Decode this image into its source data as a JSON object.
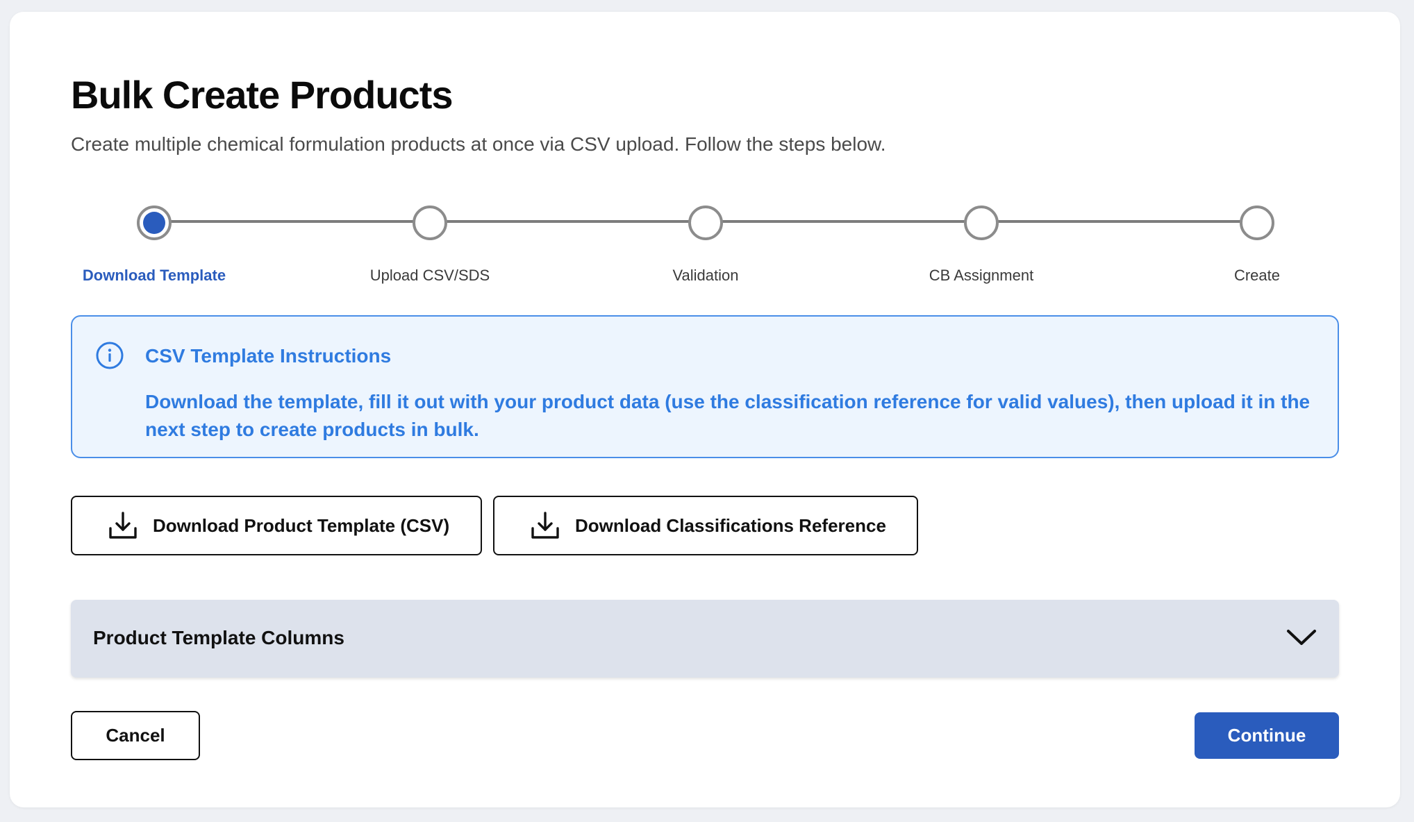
{
  "page": {
    "title": "Bulk Create Products",
    "subtitle": "Create multiple chemical formulation products at once via CSV upload. Follow the steps below."
  },
  "stepper": {
    "active_index": 0,
    "steps": [
      {
        "label": "Download Template"
      },
      {
        "label": "Upload CSV/SDS"
      },
      {
        "label": "Validation"
      },
      {
        "label": "CB Assignment"
      },
      {
        "label": "Create"
      }
    ]
  },
  "info": {
    "icon": "info-circle-icon",
    "title": "CSV Template Instructions",
    "body": "Download the template, fill it out with your product data (use the classification reference for valid values), then upload it in the next step to create products in bulk."
  },
  "downloads": {
    "template_label": "Download Product Template (CSV)",
    "classifications_label": "Download Classifications Reference",
    "icon": "download-icon"
  },
  "accordion": {
    "title": "Product Template Columns",
    "expanded": false,
    "icon": "chevron-down-icon"
  },
  "footer": {
    "cancel_label": "Cancel",
    "continue_label": "Continue"
  },
  "colors": {
    "primary": "#2a5cbd",
    "info_text": "#2f7be0",
    "info_bg": "#edf5fe",
    "info_border": "#4a8ee8",
    "accordion_bg": "#dde2ec"
  }
}
